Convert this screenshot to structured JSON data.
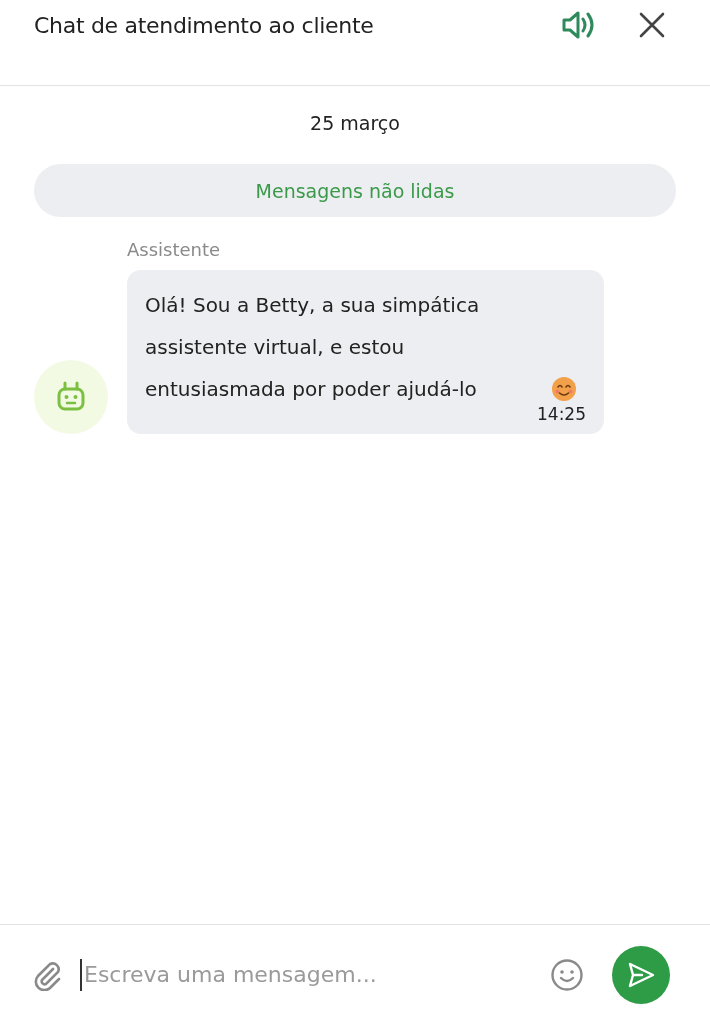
{
  "header": {
    "title": "Chat de atendimento ao cliente",
    "sound_on": true
  },
  "date": "25 março",
  "unread_banner": "Mensagens não lidas",
  "messages": [
    {
      "sender": "Assistente",
      "text": "Olá! Sou a Betty, a sua simpática assistente virtual, e estou entusiasmada por poder ajudá-lo",
      "time": "14:25"
    }
  ],
  "composer": {
    "placeholder": "Escreva uma mensagem..."
  }
}
